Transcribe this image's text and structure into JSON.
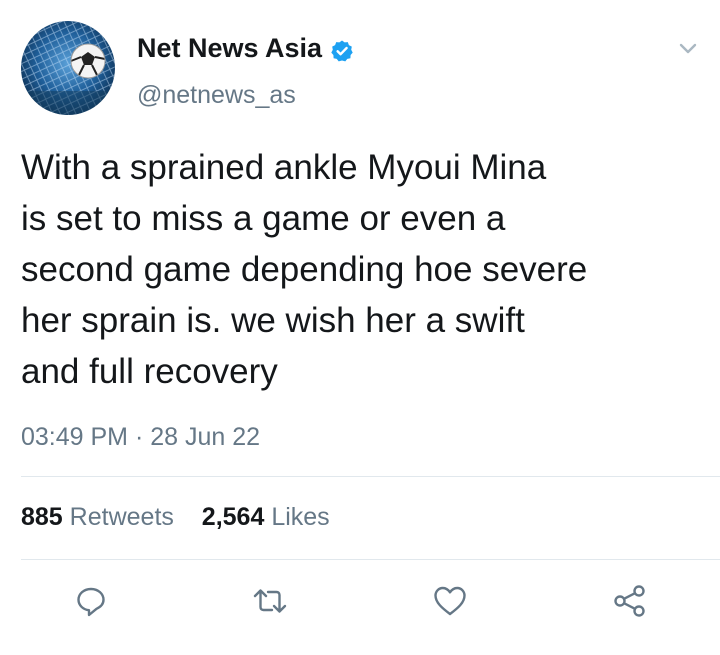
{
  "user": {
    "display_name": "Net News Asia",
    "handle": "@netnews_as"
  },
  "tweet": {
    "text_lines": [
      "With a sprained ankle Myoui Mina",
      "is set to miss a game or even a",
      "second game depending hoe severe",
      "her sprain is. we wish her a swift",
      "and full recovery"
    ],
    "time": "03:49 PM",
    "separator": "·",
    "date": "28 Jun 22"
  },
  "stats": {
    "retweets_count": "885",
    "retweets_label": "Retweets",
    "likes_count": "2,564",
    "likes_label": "Likes"
  },
  "icons": {
    "verified": "verified-badge-icon",
    "menu": "chevron-down-icon",
    "reply": "reply-icon",
    "retweet": "retweet-icon",
    "like": "heart-icon",
    "share": "share-icon"
  },
  "colors": {
    "text": "#14171a",
    "secondary": "#657786",
    "verified": "#1da1f2",
    "divider": "#e1e8ed"
  }
}
